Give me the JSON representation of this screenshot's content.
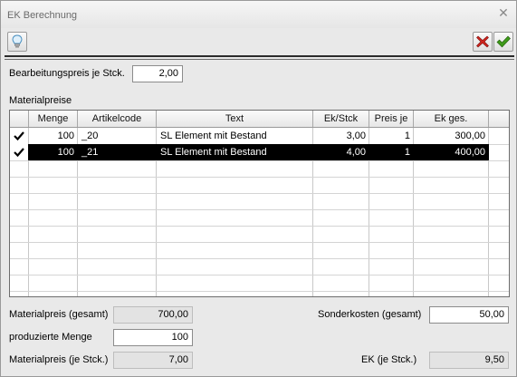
{
  "window": {
    "title": "EK Berechnung"
  },
  "form": {
    "bearbeitungspreis_label": "Bearbeitungspreis je Stck.",
    "bearbeitungspreis_value": "2,00",
    "materialpreise_label": "Materialpreise"
  },
  "table": {
    "columns": [
      "Menge",
      "Artikelcode",
      "Text",
      "Ek/Stck",
      "Preis je",
      "Ek ges."
    ],
    "rows": [
      {
        "checked": true,
        "menge": "100",
        "artikelcode": "_20",
        "text": "SL Element mit Bestand",
        "ek_stck": "3,00",
        "preis_je": "1",
        "ek_ges": "300,00",
        "selected": false
      },
      {
        "checked": true,
        "menge": "100",
        "artikelcode": "_21",
        "text": "SL Element mit Bestand",
        "ek_stck": "4,00",
        "preis_je": "1",
        "ek_ges": "400,00",
        "selected": true
      }
    ]
  },
  "summary": {
    "materialpreis_gesamt_label": "Materialpreis (gesamt)",
    "materialpreis_gesamt_value": "700,00",
    "produzierte_menge_label": "produzierte Menge",
    "produzierte_menge_value": "100",
    "materialpreis_stck_label": "Materialpreis (je Stck.)",
    "materialpreis_stck_value": "7,00",
    "sonderkosten_label": "Sonderkosten (gesamt)",
    "sonderkosten_value": "50,00",
    "ek_stck_label": "EK (je Stck.)",
    "ek_stck_value": "9,50"
  },
  "icons": {
    "hint": "lightbulb-icon",
    "cancel": "red-x-icon",
    "ok": "green-check-icon",
    "close": "close-icon"
  },
  "colors": {
    "cancel": "#d0241c",
    "ok": "#3f9a1a",
    "selected_row": "#000000"
  }
}
